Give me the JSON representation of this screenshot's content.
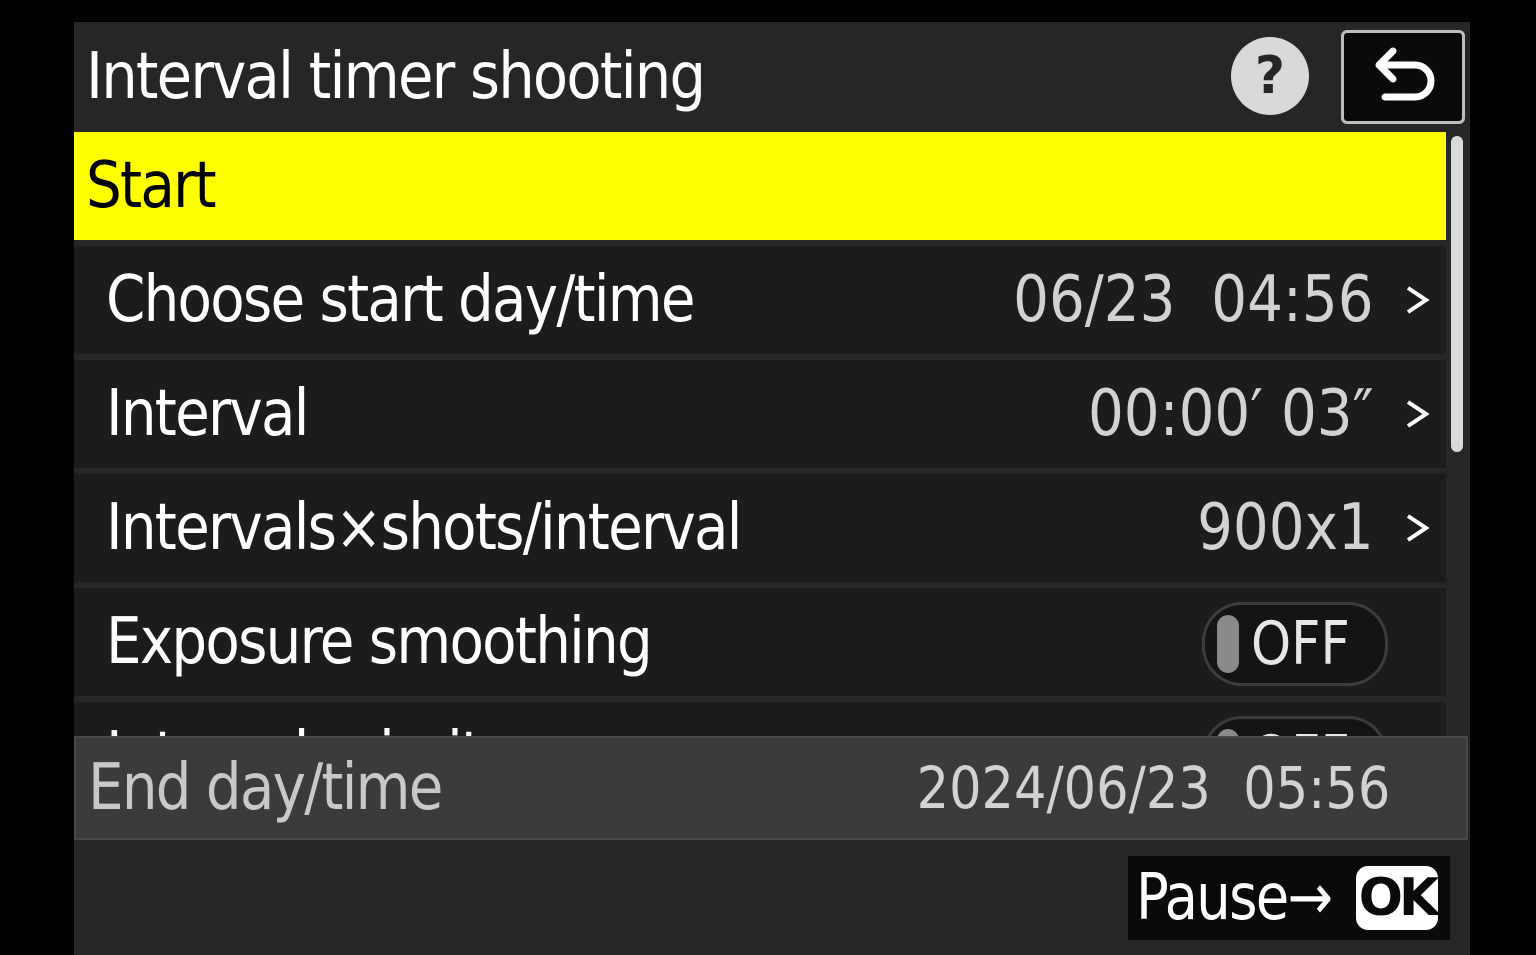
{
  "header": {
    "title": "Interval timer shooting",
    "help_glyph": "?",
    "help_icon": "help-icon",
    "back_icon": "back-return-icon"
  },
  "menu": {
    "items": [
      {
        "label": "Start",
        "value": "",
        "selected": true
      },
      {
        "label": "Choose start day/time",
        "value": "06/23  04:56",
        "chevron": true
      },
      {
        "label": "Interval",
        "value": "00:00′ 03″",
        "chevron": true
      },
      {
        "label": "Intervals×shots/interval",
        "value": "900x1",
        "chevron": true
      },
      {
        "label": "Exposure smoothing",
        "toggle": "OFF"
      },
      {
        "label": "Interval priority",
        "toggle": "OFF",
        "partially_visible": true
      }
    ]
  },
  "end": {
    "label": "End day/time",
    "value": "2024/06/23  05:56"
  },
  "footer": {
    "pause_label": "Pause→",
    "ok_label": "OK"
  },
  "colors": {
    "highlight": "#ffff00",
    "background": "#262626",
    "row": "#1c1c1c"
  }
}
